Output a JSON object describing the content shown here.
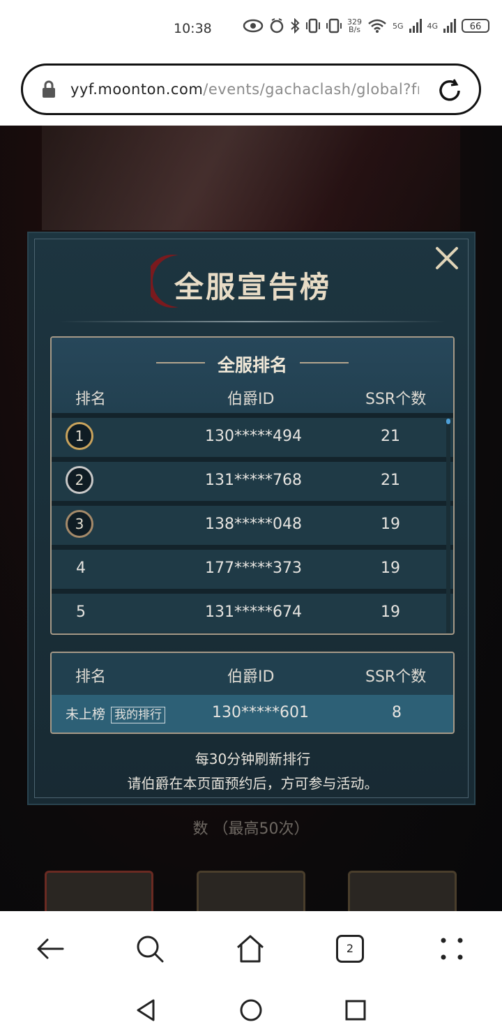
{
  "status_bar": {
    "time": "10:38",
    "net_speed_value": "329",
    "net_speed_unit": "B/s",
    "signal_1": "5G",
    "signal_2": "4G",
    "battery": "66"
  },
  "browser": {
    "url_domain": "yyf.moonton.com",
    "url_path": "/events/gachaclash/global?fron",
    "tabs_count": "2"
  },
  "page_background": {
    "partial_line": "数 （最高50次）"
  },
  "modal": {
    "title": "全服宣告榜",
    "ranking": {
      "title": "全服排名",
      "col_rank": "排名",
      "col_id": "伯爵ID",
      "col_ssr": "SSR个数",
      "rows": [
        {
          "rank": "1",
          "id": "130*****494",
          "ssr": "21"
        },
        {
          "rank": "2",
          "id": "131*****768",
          "ssr": "21"
        },
        {
          "rank": "3",
          "id": "138*****048",
          "ssr": "19"
        },
        {
          "rank": "4",
          "id": "177*****373",
          "ssr": "19"
        },
        {
          "rank": "5",
          "id": "131*****674",
          "ssr": "19"
        }
      ]
    },
    "my_rank": {
      "col_rank": "排名",
      "col_id": "伯爵ID",
      "col_ssr": "SSR个数",
      "rank": "未上榜",
      "tag": "我的排行",
      "id": "130*****601",
      "ssr": "8"
    },
    "note_1": "每30分钟刷新排行",
    "note_2": "请伯爵在本页面预约后，方可参与活动。"
  },
  "colors": {
    "modal_bg": "#1a2f39",
    "accent_gold": "#c9a35c",
    "highlight_row": "#2d6076"
  }
}
